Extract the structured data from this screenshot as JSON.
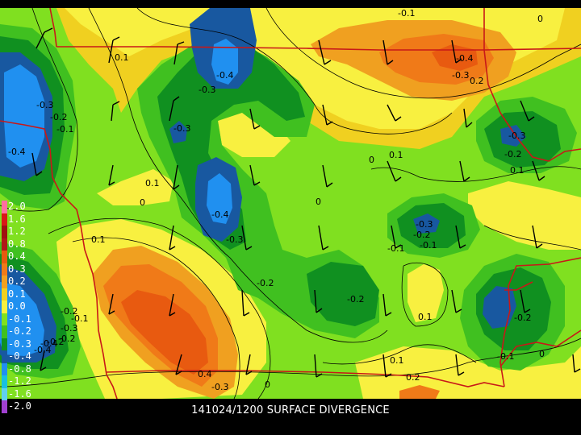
{
  "caption": "141024/1200 SURFACE DIVERGENCE",
  "legend": [
    {
      "label": "2.0",
      "color": "#ff6fa0"
    },
    {
      "label": "1.6",
      "color": "#d81818"
    },
    {
      "label": "1.2",
      "color": "#a01010"
    },
    {
      "label": "0.8",
      "color": "#b01818"
    },
    {
      "label": "0.4",
      "color": "#e85a10"
    },
    {
      "label": "0.3",
      "color": "#f07a18"
    },
    {
      "label": "0.2",
      "color": "#f0a020"
    },
    {
      "label": "0.1",
      "color": "#f0d020"
    },
    {
      "label": "0.0",
      "color": "#f8f040"
    },
    {
      "label": "-0.1",
      "color": "#80e020"
    },
    {
      "label": "-0.2",
      "color": "#40c020"
    },
    {
      "label": "-0.3",
      "color": "#109020"
    },
    {
      "label": "-0.4",
      "color": "#1858a0"
    },
    {
      "label": "-0.8",
      "color": "#2090f0"
    },
    {
      "label": "-1.2",
      "color": "#18c0e0"
    },
    {
      "label": "-1.6",
      "color": "#60d0f0"
    },
    {
      "label": "-2.0",
      "color": "#a040d0"
    }
  ],
  "contour_labels": [
    "-0.1",
    "0",
    "-0.4",
    "-0.3",
    "0.1",
    "-0.4",
    "0.2",
    "-0.3",
    "-0.2",
    "-0.1",
    "-0.3",
    "-0.4",
    "-0.3",
    "-0.2",
    "0.1",
    "0.1",
    "0",
    "0",
    "-0.4",
    "-0.3",
    "-0.2",
    "0",
    "0.1",
    "-0.3",
    "-0.2",
    "-0.1",
    "0.1",
    "-0.2",
    "-0.2",
    "-0.1",
    "-0.3",
    "-0.2",
    "-0.4",
    "0.1",
    "-0.2",
    "0.4",
    "-0.3",
    "0",
    "0.1",
    "0.2",
    "-0.1",
    "0",
    "-0.4",
    "-0.3",
    "-0.2",
    "-0.1"
  ],
  "colors": {
    "background": "#000000",
    "state_borders": "#c81818",
    "wind_barbs": "#000000",
    "contour_lines": "#000000"
  }
}
